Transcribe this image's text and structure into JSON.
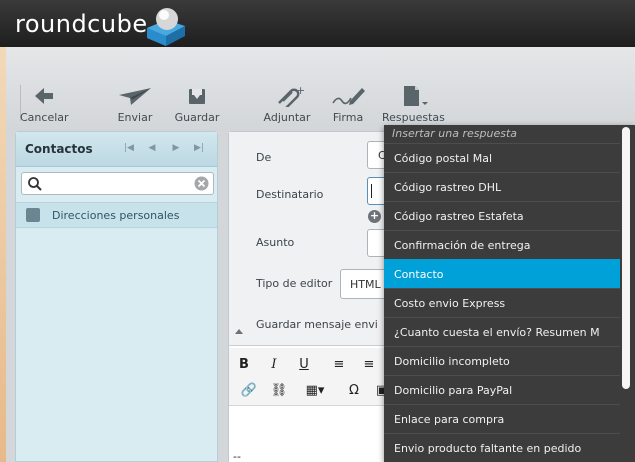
{
  "app": {
    "logo": "roundcube"
  },
  "toolbar": {
    "cancel": "Cancelar",
    "send": "Enviar",
    "save": "Guardar",
    "attach": "Adjuntar",
    "signature": "Firma",
    "responses": "Respuestas"
  },
  "contacts": {
    "title": "Contactos",
    "search_value": "",
    "address_book": "Direcciones personales"
  },
  "compose": {
    "from_label": "De",
    "from_value": "C",
    "to_label": "Destinatario",
    "subject_label": "Asunto",
    "editor_type_label": "Tipo de editor",
    "editor_type_value": "HTML",
    "save_sent_label": "Guardar mensaje envi",
    "signature_marker": "--"
  },
  "responses_menu": {
    "header": "Insertar una respuesta",
    "items": [
      "Código postal Mal",
      "Código rastreo DHL",
      "Código rastreo Estafeta",
      "Confirmación de entrega",
      "Contacto",
      "Costo envio Express",
      "¿Cuanto cuesta el envío? Resumen M",
      "Domicilio incompleto",
      "Domicilio para PayPal",
      "Enlace para compra",
      "Envio producto faltante en pedido"
    ],
    "active_index": 4
  },
  "colors": {
    "header_bg": "#2a2a2a",
    "menu_bg": "#3c3c3c",
    "menu_active": "#00a0d8",
    "contacts_bg": "#d9ecf2"
  }
}
